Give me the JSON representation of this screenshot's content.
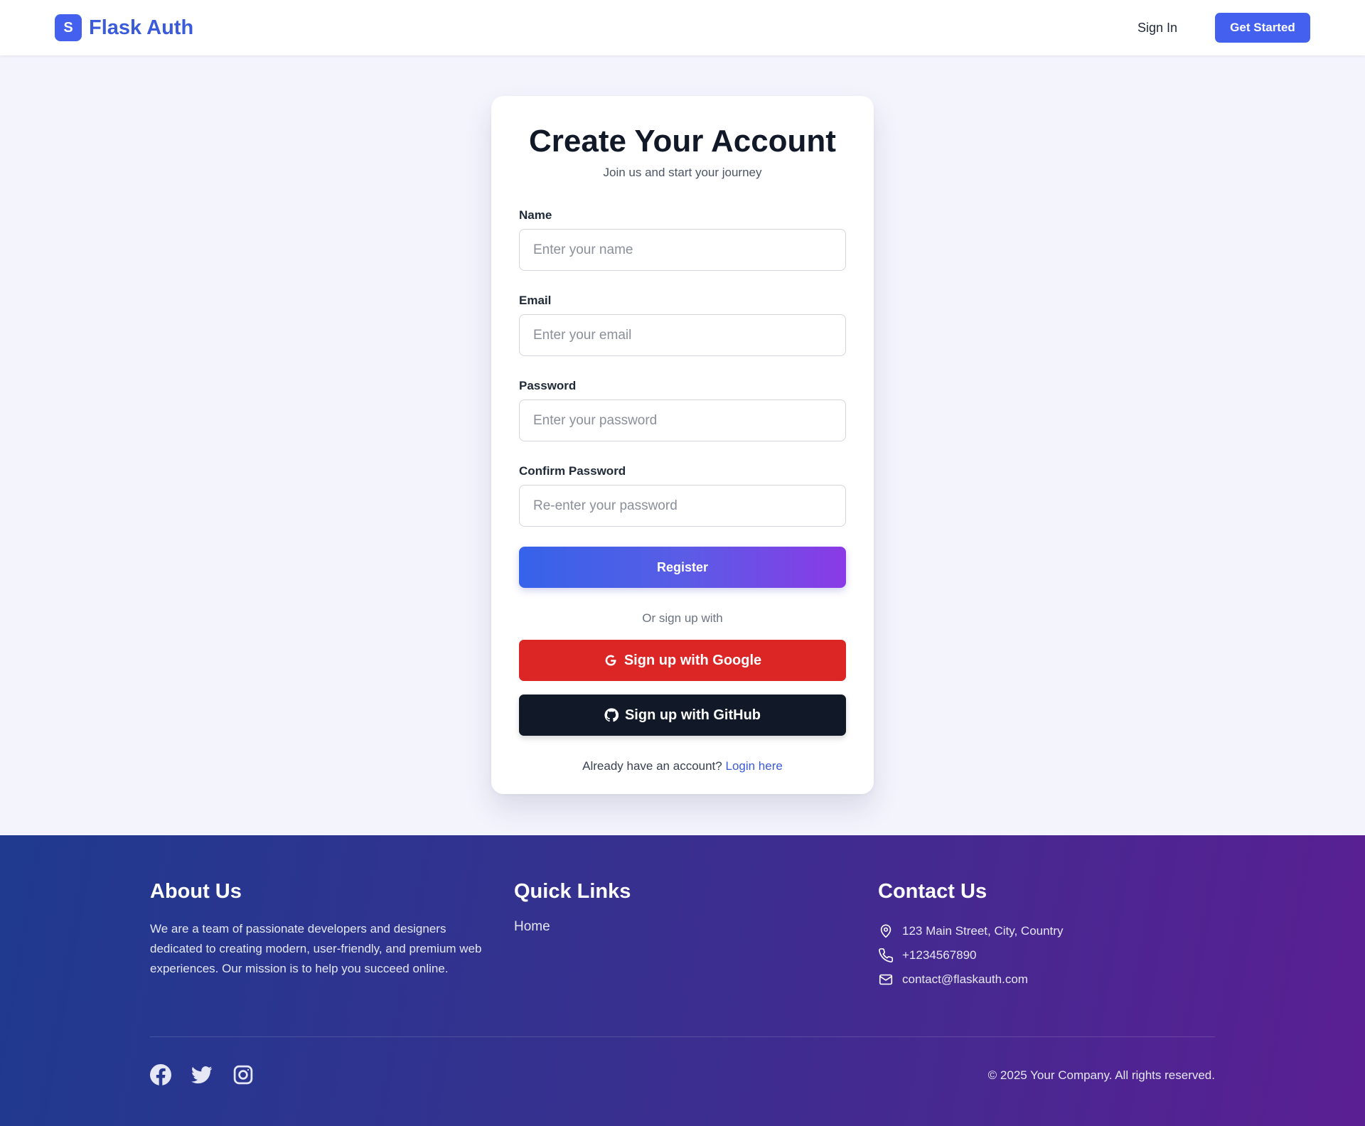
{
  "header": {
    "brand_badge": "S",
    "brand_name": "Flask Auth",
    "signin_label": "Sign In",
    "get_started_label": "Get Started"
  },
  "form": {
    "title": "Create Your Account",
    "subtitle": "Join us and start your journey",
    "fields": [
      {
        "label": "Name",
        "placeholder": "Enter your name",
        "value": ""
      },
      {
        "label": "Email",
        "placeholder": "Enter your email",
        "value": ""
      },
      {
        "label": "Password",
        "placeholder": "Enter your password",
        "value": ""
      },
      {
        "label": "Confirm Password",
        "placeholder": "Re-enter your password",
        "value": ""
      }
    ],
    "register_label": "Register",
    "or_text": "Or sign up with",
    "google_label": "Sign up with Google",
    "github_label": "Sign up with GitHub",
    "login_prompt": "Already have an account?",
    "login_link": "Login here"
  },
  "footer": {
    "about": {
      "title": "About Us",
      "text": "We are a team of passionate developers and designers dedicated to creating modern, user-friendly, and premium web experiences. Our mission is to help you succeed online."
    },
    "links": {
      "title": "Quick Links",
      "items": [
        "Home"
      ]
    },
    "contact": {
      "title": "Contact Us",
      "address": "123 Main Street, City, Country",
      "phone": "+1234567890",
      "email": "contact@flaskauth.com"
    },
    "social_icons": [
      "facebook-icon",
      "twitter-icon",
      "instagram-icon"
    ],
    "copyright": "© 2025 Your Company. All rights reserved."
  },
  "colors": {
    "accent": "#4361ee",
    "google": "#dc2626",
    "github": "#111827"
  }
}
